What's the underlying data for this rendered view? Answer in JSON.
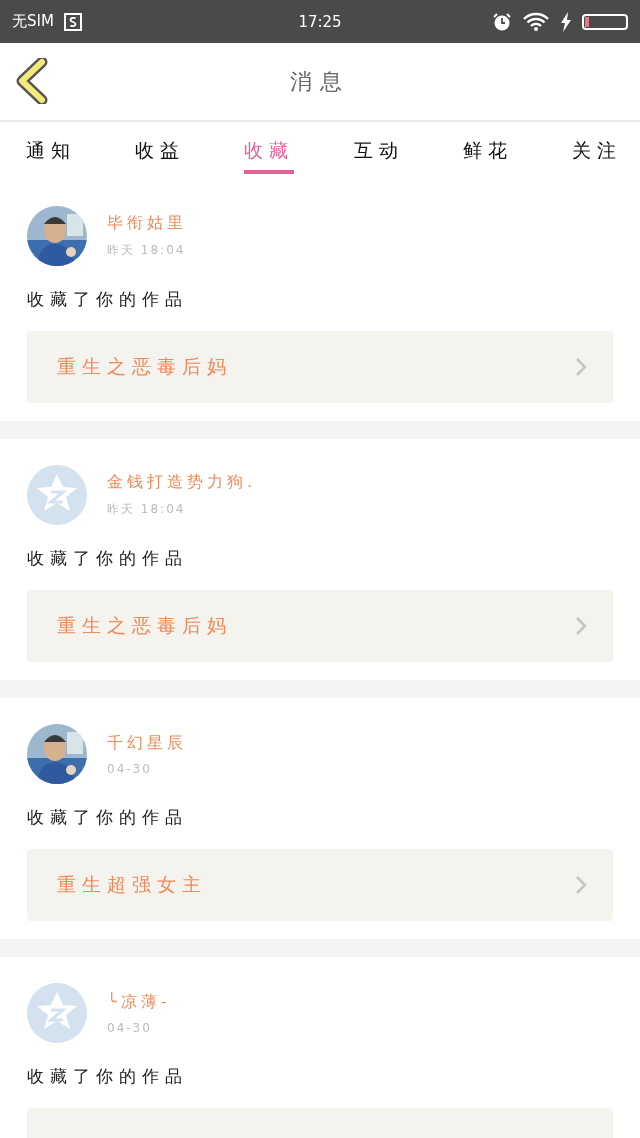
{
  "status_bar": {
    "carrier": "无SIM",
    "time": "17:25"
  },
  "header": {
    "title": "消息"
  },
  "tabs": [
    {
      "label": "通知",
      "selected": false
    },
    {
      "label": "收益",
      "selected": false
    },
    {
      "label": "收藏",
      "selected": true
    },
    {
      "label": "互动",
      "selected": false
    },
    {
      "label": "鲜花",
      "selected": false
    },
    {
      "label": "关注",
      "selected": false
    }
  ],
  "messages": [
    {
      "name": "毕衔姑里",
      "time": "昨天 18:04",
      "text": "收藏了你的作品",
      "work": "重生之恶毒后妈"
    },
    {
      "avatar": {
        "kind": "default"
      },
      "name": "金钱打造势力狗.",
      "time": "昨天 18:04",
      "text": "收藏了你的作品",
      "work": "重生之恶毒后妈"
    },
    {
      "name": "千幻星辰",
      "time": "04-30",
      "text": "收藏了你的作品",
      "work": "重生超强女主"
    },
    {
      "avatar": {
        "kind": "default"
      },
      "name": "╰凉薄-",
      "time": "04-30",
      "text": "收藏了你的作品"
    }
  ]
}
